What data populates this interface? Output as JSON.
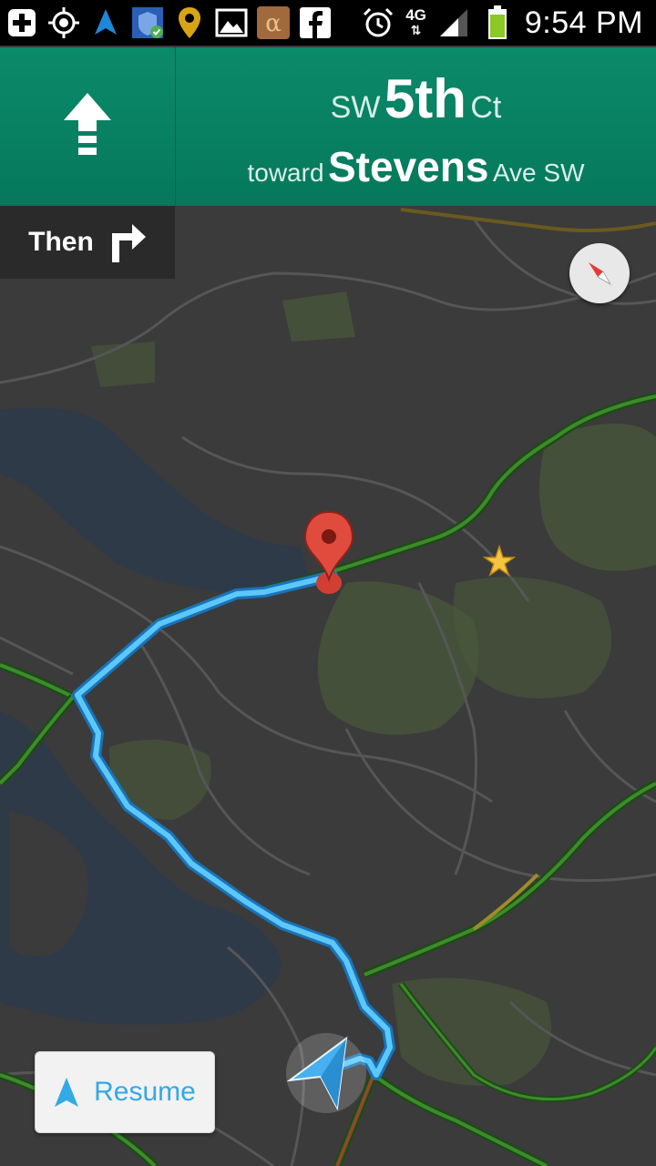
{
  "status_bar": {
    "time": "9:54 PM",
    "network": "4G",
    "icons": [
      "add-icon",
      "gps-icon",
      "navigation-icon",
      "shield-icon",
      "location-pin-icon",
      "gallery-icon",
      "alpha-app-icon",
      "facebook-icon",
      "alarm-icon",
      "network-4g-icon",
      "signal-icon",
      "battery-icon"
    ]
  },
  "navigation": {
    "maneuver_icon": "straight-arrow-icon",
    "street_prefix": "SW",
    "street_name": "5th",
    "street_suffix": "Ct",
    "toward_label": "toward",
    "toward_name": "Stevens",
    "toward_suffix": "Ave SW"
  },
  "then": {
    "label": "Then",
    "icon": "turn-right-icon"
  },
  "map": {
    "compass_icon": "compass-icon",
    "destination_icon": "destination-pin-icon",
    "starred_icon": "star-icon",
    "current_location_icon": "location-arrow-icon",
    "route_color": "#35b6f4"
  },
  "resume": {
    "label": "Resume",
    "icon": "navigation-arrow-icon"
  },
  "colors": {
    "header": "#07805f",
    "map_background": "#3a3a3a",
    "traffic_green": "#2f6b1f",
    "destination_red": "#e04b3d"
  }
}
